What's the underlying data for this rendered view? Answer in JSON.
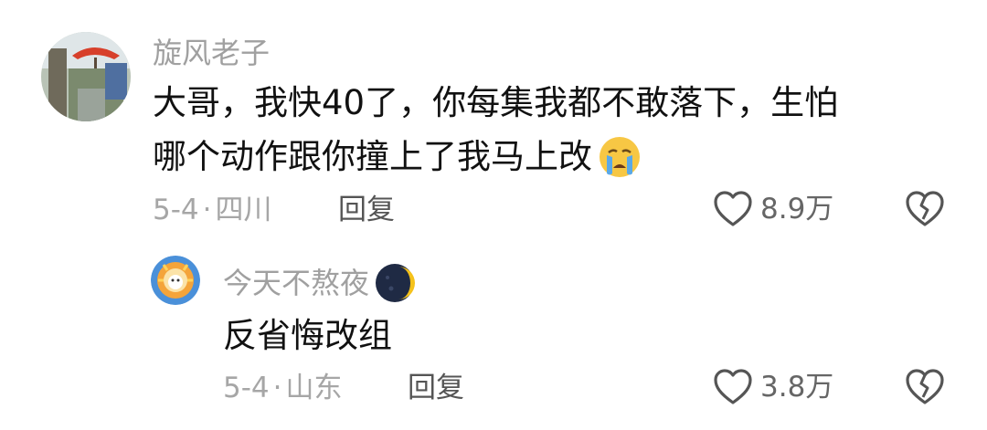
{
  "comments": [
    {
      "author": "旋风老子",
      "text_line1": "大哥，我快40了，你每集我都不敢落下，生怕",
      "text_line2": "哪个动作跟你撞上了我马上改",
      "emoji": "crying-face-icon",
      "date": "5-4",
      "location": "四川",
      "reply_label": "回复",
      "likes": "8.9万"
    },
    {
      "author": "今天不熬夜",
      "author_badge": "moon-icon",
      "text": "反省悔改组",
      "date": "5-4",
      "location": "山东",
      "reply_label": "回复",
      "likes": "3.8万"
    }
  ],
  "meta_separator": "·"
}
